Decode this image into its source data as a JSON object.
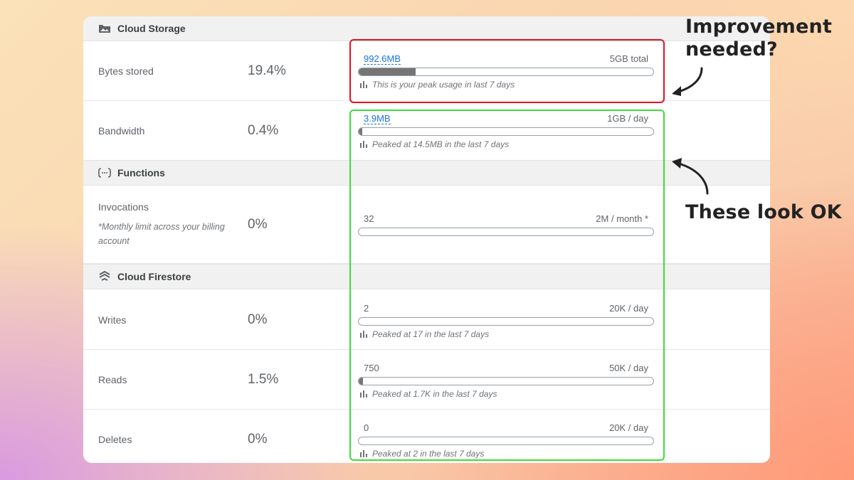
{
  "sections": {
    "storage": {
      "title": "Cloud Storage",
      "icon": "folder-image-icon"
    },
    "functions": {
      "title": "Functions",
      "icon": "functions-icon"
    },
    "firestore": {
      "title": "Cloud Firestore",
      "icon": "firestore-icon"
    }
  },
  "rows": {
    "bytes": {
      "label": "Bytes stored",
      "pct": "19.4%",
      "value": "992.6MB",
      "limit": "5GB total",
      "fill": 0.194,
      "peak": "This is your peak usage in last 7 days"
    },
    "bandwidth": {
      "label": "Bandwidth",
      "pct": "0.4%",
      "value": "3.9MB",
      "limit": "1GB / day",
      "fill": 0.004,
      "peak": "Peaked at 14.5MB in the last 7 days"
    },
    "invocations": {
      "label": "Invocations",
      "note": "*Monthly limit across your billing account",
      "pct": "0%",
      "value": "32",
      "limit": "2M / month *",
      "fill": 0
    },
    "writes": {
      "label": "Writes",
      "pct": "0%",
      "value": "2",
      "limit": "20K / day",
      "fill": 0,
      "peak": "Peaked at 17 in the last 7 days"
    },
    "reads": {
      "label": "Reads",
      "pct": "1.5%",
      "value": "750",
      "limit": "50K / day",
      "fill": 0.015,
      "peak": "Peaked at 1.7K in the last 7 days"
    },
    "deletes": {
      "label": "Deletes",
      "pct": "0%",
      "value": "0",
      "limit": "20K / day",
      "fill": 0,
      "peak": "Peaked at 2 in the last 7 days"
    }
  },
  "annotations": {
    "improvement": "Improvement needed?",
    "ok": "These look OK"
  },
  "colors": {
    "red_box": "#e0141e",
    "green_box": "#3ddc3a",
    "link": "#1a73e8",
    "bar_fill": "#757575"
  }
}
